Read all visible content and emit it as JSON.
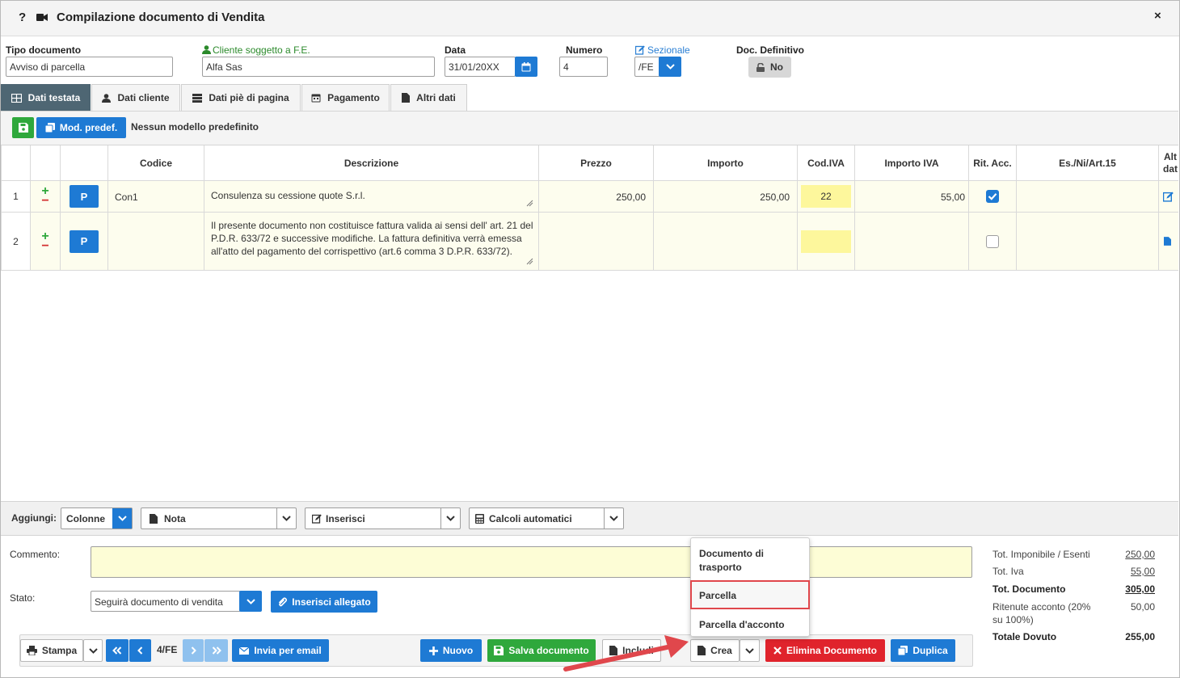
{
  "window": {
    "help_symbol": "?",
    "title": "Compilazione documento di Vendita",
    "close_symbol": "×"
  },
  "header": {
    "tipo_label": "Tipo documento",
    "tipo_value": "Avviso di parcella",
    "cliente_label": "Cliente soggetto a F.E.",
    "cliente_value": "Alfa Sas",
    "data_label": "Data",
    "data_value": "31/01/20XX",
    "numero_label": "Numero",
    "numero_value": "4",
    "sezionale_label": "Sezionale",
    "sezionale_value": "/FE",
    "definitivo_label": "Doc. Definitivo",
    "definitivo_value": "No"
  },
  "tabs": [
    {
      "label": "Dati testata",
      "icon": "table-icon",
      "active": true
    },
    {
      "label": "Dati cliente",
      "icon": "user-icon",
      "active": false
    },
    {
      "label": "Dati piè di pagina",
      "icon": "list-icon",
      "active": false
    },
    {
      "label": "Pagamento",
      "icon": "calendar-icon",
      "active": false
    },
    {
      "label": "Altri dati",
      "icon": "file-icon",
      "active": false
    }
  ],
  "model_bar": {
    "mod_button": "Mod. predef.",
    "status": "Nessun modello predefinito"
  },
  "grid": {
    "columns": [
      "Codice",
      "Descrizione",
      "Prezzo",
      "Importo",
      "Cod.IVA",
      "Importo IVA",
      "Rit. Acc.",
      "Es./Ni/Art.15",
      "Alt dat"
    ],
    "p_label": "P",
    "rows": [
      {
        "num": "1",
        "codice": "Con1",
        "descrizione": "Consulenza su cessione quote S.r.l.",
        "prezzo": "250,00",
        "importo": "250,00",
        "cod_iva": "22",
        "importo_iva": "55,00",
        "rit_acc": true
      },
      {
        "num": "2",
        "codice": "",
        "descrizione": "Il presente documento non costituisce fattura valida ai sensi dell' art. 21 del P.D.R. 633/72 e  successive modifiche. La fattura definitiva verrà emessa all'atto del pagamento del corrispettivo (art.6 comma 3 D.P.R. 633/72).",
        "prezzo": "",
        "importo": "",
        "cod_iva": "",
        "importo_iva": "",
        "rit_acc": false
      }
    ]
  },
  "add_bar": {
    "label": "Aggiungi:",
    "colonne": "Colonne",
    "nota": "Nota",
    "inserisci": "Inserisci",
    "calcoli": "Calcoli automatici"
  },
  "footer": {
    "commento_label": "Commento:",
    "stato_label": "Stato:",
    "stato_value": "Seguirà documento di vendita",
    "allegato_button": "Inserisci allegato",
    "stampa": "Stampa",
    "doc_ref": "4/FE",
    "email": "Invia per email",
    "nuovo": "Nuovo",
    "salva": "Salva documento",
    "includi": "Includi",
    "crea": "Crea",
    "elimina": "Elimina Documento",
    "duplica": "Duplica"
  },
  "totals": {
    "imponibile_label": "Tot. Imponibile / Esenti",
    "imponibile_value": "250,00",
    "iva_label": "Tot. Iva",
    "iva_value": "55,00",
    "documento_label": "Tot. Documento",
    "documento_value": "305,00",
    "ritenute_label_1": "Ritenute acconto (20%",
    "ritenute_label_2": "su 100%)",
    "ritenute_value": "50,00",
    "dovuto_label": "Totale Dovuto",
    "dovuto_value": "255,00"
  },
  "crea_menu": {
    "items": [
      "Documento di",
      "trasporto",
      "Parcella",
      "Parcella d'acconto"
    ]
  },
  "colors": {
    "accent_blue": "#1e7ad4",
    "tab_active": "#4e6673",
    "green": "#2fa83c",
    "red": "#e0232c",
    "row_bg": "#fdfdee",
    "iva_yellow": "#fdf79c",
    "annotation_arrow": "#e0474c"
  }
}
